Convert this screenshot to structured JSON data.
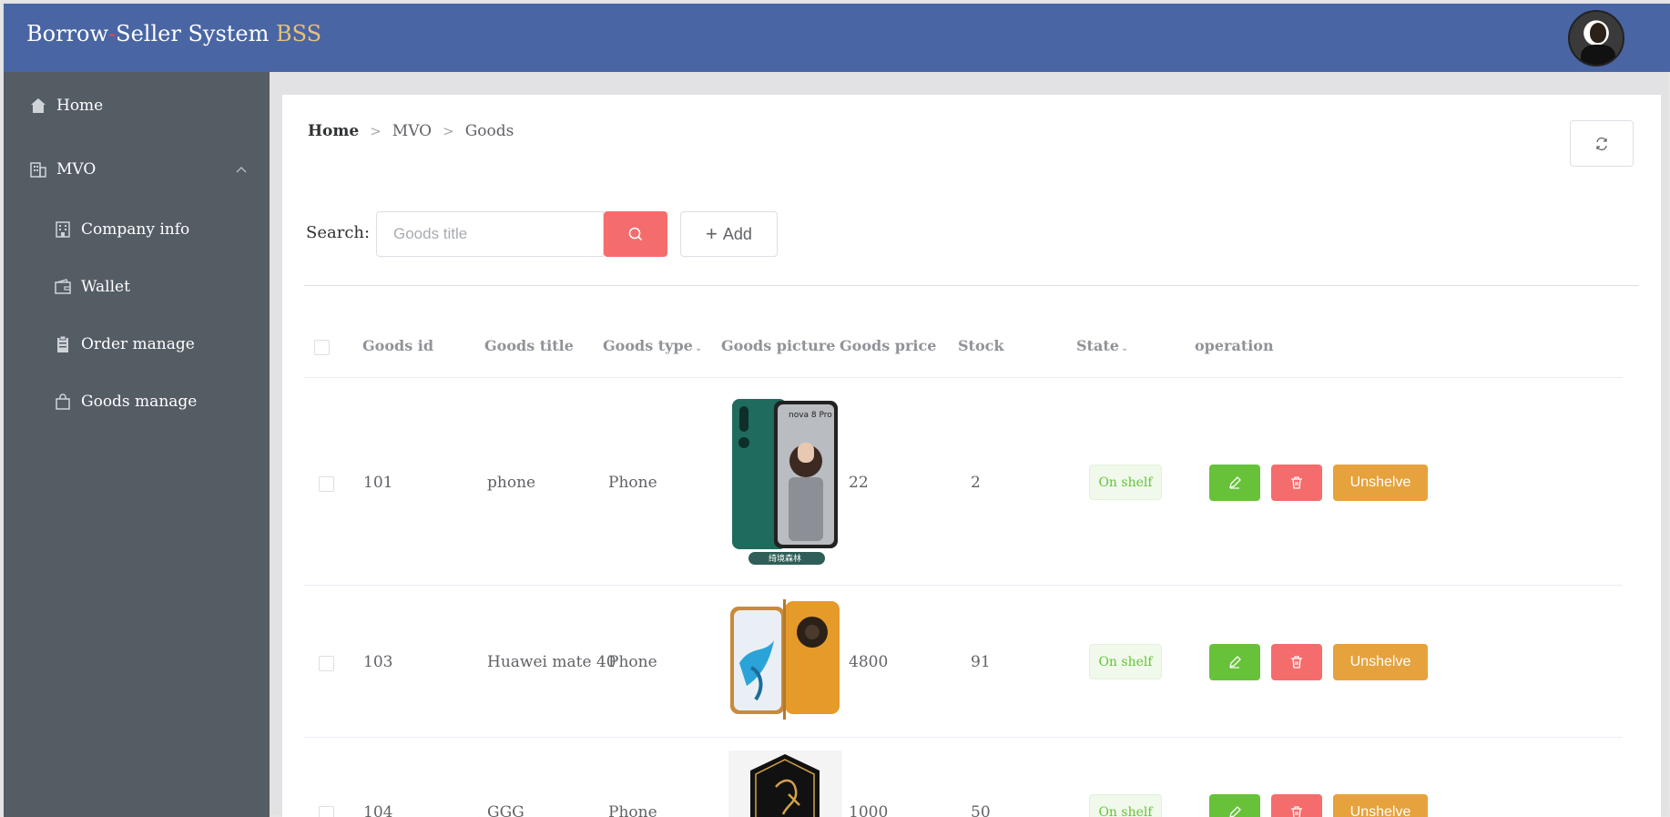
{
  "header": {
    "brand_part1": "Borrow",
    "brand_dash": "-",
    "brand_part2": "Seller System ",
    "brand_accent": "BSS"
  },
  "sidebar": {
    "items": [
      {
        "label": "Home",
        "icon": "home-icon"
      },
      {
        "label": "MVO",
        "icon": "office-building-icon"
      },
      {
        "label": "Company info",
        "icon": "company-building-icon"
      },
      {
        "label": "Wallet",
        "icon": "wallet-icon"
      },
      {
        "label": "Order manage",
        "icon": "clipboard-icon"
      },
      {
        "label": "Goods manage",
        "icon": "shopping-bag-icon"
      }
    ]
  },
  "breadcrumb": [
    "Home",
    "MVO",
    "Goods"
  ],
  "search": {
    "label": "Search:",
    "placeholder": "Goods title",
    "value": ""
  },
  "add_label": "Add",
  "table": {
    "columns": [
      "Goods id",
      "Goods title",
      "Goods type",
      "Goods picture",
      "Goods price",
      "Stock",
      "State",
      "operation"
    ],
    "rows": [
      {
        "id": "101",
        "title": "phone",
        "type": "Phone",
        "price": "22",
        "stock": "2",
        "state": "On shelf",
        "action": "Unshelve",
        "picture": "Green phone with promo photo, nova 8 Pro",
        "pic_text": "nova 8 Pro",
        "pic_caption": "绮境森林"
      },
      {
        "id": "103",
        "title": "Huawei mate 40",
        "type": "Phone",
        "price": "4800",
        "stock": "91",
        "state": "On shelf",
        "action": "Unshelve",
        "picture": "Orange Huawei Mate 40 phone front and back"
      },
      {
        "id": "104",
        "title": "GGG",
        "type": "Phone",
        "price": "1000",
        "stock": "50",
        "state": "On shelf",
        "action": "Unshelve",
        "picture": "Black badge emblem with gold lion"
      }
    ]
  },
  "colors": {
    "header_bg": "#4965a3",
    "sidebar_bg": "#545c64",
    "danger": "#f56c6c",
    "success": "#67c23a",
    "warning": "#e6a23c",
    "brand_accent": "#e8c07a"
  }
}
